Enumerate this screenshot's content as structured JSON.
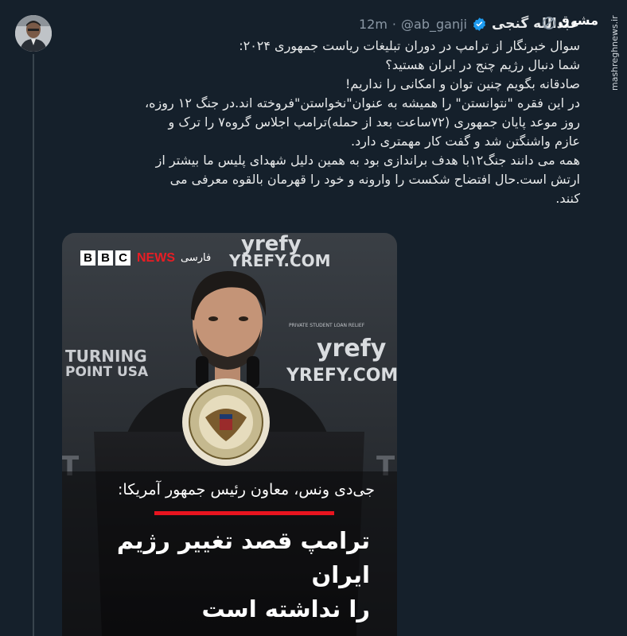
{
  "tweet": {
    "author_name": "عبدالله گنجی",
    "handle": "@ab_ganji",
    "separator": "·",
    "time": "12m",
    "text_lines": [
      "سوال خبرنگار از ترامپ در دوران تبلیغات ریاست جمهوری ۲۰۲۴:",
      "شما دنبال رژیم چنج در ایران هستید؟",
      "صادقانه بگویم چنین توان و امکانی را نداریم!",
      "در این فقره \"نتوانستن\" را همیشه به عنوان\"نخواستن\"فروخته اند.در جنگ ۱۲ روزه، روز موعد پایان جمهوری (۷۲ساعت بعد از حمله)ترامپ اجلاس گروه۷ را ترک و عازم واشنگتن شد و گفت کار مهمتری دارد.",
      "همه می دانند جنگ۱۲با هدف براندازی بود به همین دلیل شهدای پلیس ما بیشتر از ارتش است.حال افتضاح شکست را وارونه و خود را قهرمان بالقوه معرفی می کنند."
    ]
  },
  "watermark": {
    "logo_text": "مشرق",
    "url": "mashreghnews.ir"
  },
  "media": {
    "bbc_letters": [
      "B",
      "B",
      "C"
    ],
    "bbc_news": "NEWS",
    "bbc_language": "فارسی",
    "backdrop_text_1": "yrefy",
    "backdrop_text_2": "YREFY.COM",
    "backdrop_text_3": "TURNING",
    "backdrop_text_4": "POINT USA",
    "backdrop_small": "PRIVATE STUDENT LOAN RELIEF",
    "caption_subtitle": "جی‌دی ونس، معاون رئیس جمهور آمریکا:",
    "caption_headline_1": "ترامپ قصد تغییر رژیم ایران",
    "caption_headline_2": "را نداشته است"
  },
  "colors": {
    "background": "#15202b",
    "verified": "#1d9bf0",
    "bbc_red": "#e81d24"
  }
}
